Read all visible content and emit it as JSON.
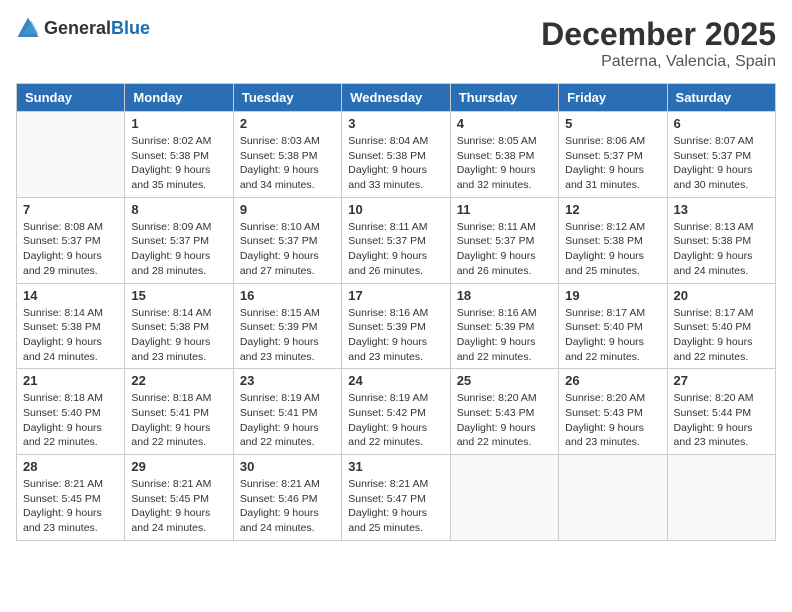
{
  "header": {
    "logo_general": "General",
    "logo_blue": "Blue",
    "month": "December 2025",
    "location": "Paterna, Valencia, Spain"
  },
  "weekdays": [
    "Sunday",
    "Monday",
    "Tuesday",
    "Wednesday",
    "Thursday",
    "Friday",
    "Saturday"
  ],
  "weeks": [
    [
      {
        "day": "",
        "info": ""
      },
      {
        "day": "1",
        "info": "Sunrise: 8:02 AM\nSunset: 5:38 PM\nDaylight: 9 hours\nand 35 minutes."
      },
      {
        "day": "2",
        "info": "Sunrise: 8:03 AM\nSunset: 5:38 PM\nDaylight: 9 hours\nand 34 minutes."
      },
      {
        "day": "3",
        "info": "Sunrise: 8:04 AM\nSunset: 5:38 PM\nDaylight: 9 hours\nand 33 minutes."
      },
      {
        "day": "4",
        "info": "Sunrise: 8:05 AM\nSunset: 5:38 PM\nDaylight: 9 hours\nand 32 minutes."
      },
      {
        "day": "5",
        "info": "Sunrise: 8:06 AM\nSunset: 5:37 PM\nDaylight: 9 hours\nand 31 minutes."
      },
      {
        "day": "6",
        "info": "Sunrise: 8:07 AM\nSunset: 5:37 PM\nDaylight: 9 hours\nand 30 minutes."
      }
    ],
    [
      {
        "day": "7",
        "info": "Sunrise: 8:08 AM\nSunset: 5:37 PM\nDaylight: 9 hours\nand 29 minutes."
      },
      {
        "day": "8",
        "info": "Sunrise: 8:09 AM\nSunset: 5:37 PM\nDaylight: 9 hours\nand 28 minutes."
      },
      {
        "day": "9",
        "info": "Sunrise: 8:10 AM\nSunset: 5:37 PM\nDaylight: 9 hours\nand 27 minutes."
      },
      {
        "day": "10",
        "info": "Sunrise: 8:11 AM\nSunset: 5:37 PM\nDaylight: 9 hours\nand 26 minutes."
      },
      {
        "day": "11",
        "info": "Sunrise: 8:11 AM\nSunset: 5:37 PM\nDaylight: 9 hours\nand 26 minutes."
      },
      {
        "day": "12",
        "info": "Sunrise: 8:12 AM\nSunset: 5:38 PM\nDaylight: 9 hours\nand 25 minutes."
      },
      {
        "day": "13",
        "info": "Sunrise: 8:13 AM\nSunset: 5:38 PM\nDaylight: 9 hours\nand 24 minutes."
      }
    ],
    [
      {
        "day": "14",
        "info": "Sunrise: 8:14 AM\nSunset: 5:38 PM\nDaylight: 9 hours\nand 24 minutes."
      },
      {
        "day": "15",
        "info": "Sunrise: 8:14 AM\nSunset: 5:38 PM\nDaylight: 9 hours\nand 23 minutes."
      },
      {
        "day": "16",
        "info": "Sunrise: 8:15 AM\nSunset: 5:39 PM\nDaylight: 9 hours\nand 23 minutes."
      },
      {
        "day": "17",
        "info": "Sunrise: 8:16 AM\nSunset: 5:39 PM\nDaylight: 9 hours\nand 23 minutes."
      },
      {
        "day": "18",
        "info": "Sunrise: 8:16 AM\nSunset: 5:39 PM\nDaylight: 9 hours\nand 22 minutes."
      },
      {
        "day": "19",
        "info": "Sunrise: 8:17 AM\nSunset: 5:40 PM\nDaylight: 9 hours\nand 22 minutes."
      },
      {
        "day": "20",
        "info": "Sunrise: 8:17 AM\nSunset: 5:40 PM\nDaylight: 9 hours\nand 22 minutes."
      }
    ],
    [
      {
        "day": "21",
        "info": "Sunrise: 8:18 AM\nSunset: 5:40 PM\nDaylight: 9 hours\nand 22 minutes."
      },
      {
        "day": "22",
        "info": "Sunrise: 8:18 AM\nSunset: 5:41 PM\nDaylight: 9 hours\nand 22 minutes."
      },
      {
        "day": "23",
        "info": "Sunrise: 8:19 AM\nSunset: 5:41 PM\nDaylight: 9 hours\nand 22 minutes."
      },
      {
        "day": "24",
        "info": "Sunrise: 8:19 AM\nSunset: 5:42 PM\nDaylight: 9 hours\nand 22 minutes."
      },
      {
        "day": "25",
        "info": "Sunrise: 8:20 AM\nSunset: 5:43 PM\nDaylight: 9 hours\nand 22 minutes."
      },
      {
        "day": "26",
        "info": "Sunrise: 8:20 AM\nSunset: 5:43 PM\nDaylight: 9 hours\nand 23 minutes."
      },
      {
        "day": "27",
        "info": "Sunrise: 8:20 AM\nSunset: 5:44 PM\nDaylight: 9 hours\nand 23 minutes."
      }
    ],
    [
      {
        "day": "28",
        "info": "Sunrise: 8:21 AM\nSunset: 5:45 PM\nDaylight: 9 hours\nand 23 minutes."
      },
      {
        "day": "29",
        "info": "Sunrise: 8:21 AM\nSunset: 5:45 PM\nDaylight: 9 hours\nand 24 minutes."
      },
      {
        "day": "30",
        "info": "Sunrise: 8:21 AM\nSunset: 5:46 PM\nDaylight: 9 hours\nand 24 minutes."
      },
      {
        "day": "31",
        "info": "Sunrise: 8:21 AM\nSunset: 5:47 PM\nDaylight: 9 hours\nand 25 minutes."
      },
      {
        "day": "",
        "info": ""
      },
      {
        "day": "",
        "info": ""
      },
      {
        "day": "",
        "info": ""
      }
    ]
  ]
}
